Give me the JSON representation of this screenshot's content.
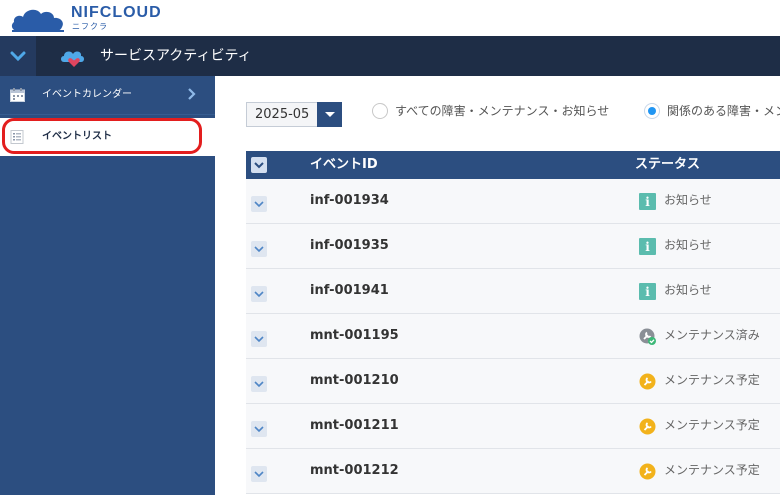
{
  "brand": {
    "name": "NIFCLOUD",
    "sub": "ニフクラ",
    "color": "#2a5ca8"
  },
  "navbar": {
    "title": "サービスアクティビティ",
    "toggle_icon": "chevron-down-icon"
  },
  "sidebar": {
    "items": [
      {
        "label": "イベントカレンダー",
        "icon": "calendar-icon",
        "active": false
      },
      {
        "label": "イベントリスト",
        "icon": "list-icon",
        "active": true
      }
    ]
  },
  "filters": {
    "month": "2025-05",
    "radios": [
      {
        "label": "すべての障害・メンテナンス・お知らせ",
        "checked": false
      },
      {
        "label": "関係のある障害・メンテナンス・お知らせ",
        "checked": true
      }
    ]
  },
  "table": {
    "columns": [
      "イベントID",
      "ステータス"
    ],
    "rows": [
      {
        "id": "inf-001934",
        "status": "お知らせ",
        "type": "info"
      },
      {
        "id": "inf-001935",
        "status": "お知らせ",
        "type": "info"
      },
      {
        "id": "inf-001941",
        "status": "お知らせ",
        "type": "info"
      },
      {
        "id": "mnt-001195",
        "status": "メンテナンス済み",
        "type": "done"
      },
      {
        "id": "mnt-001210",
        "status": "メンテナンス予定",
        "type": "planned"
      },
      {
        "id": "mnt-001211",
        "status": "メンテナンス予定",
        "type": "planned"
      },
      {
        "id": "mnt-001212",
        "status": "メンテナンス予定",
        "type": "planned"
      }
    ]
  },
  "colors": {
    "navbar": "#1e2d46",
    "sidebar": "#2c4e80",
    "highlight": "#e31e1e",
    "info": "#5bbcae",
    "planned": "#f2b21b",
    "done": "#8a8f96"
  }
}
